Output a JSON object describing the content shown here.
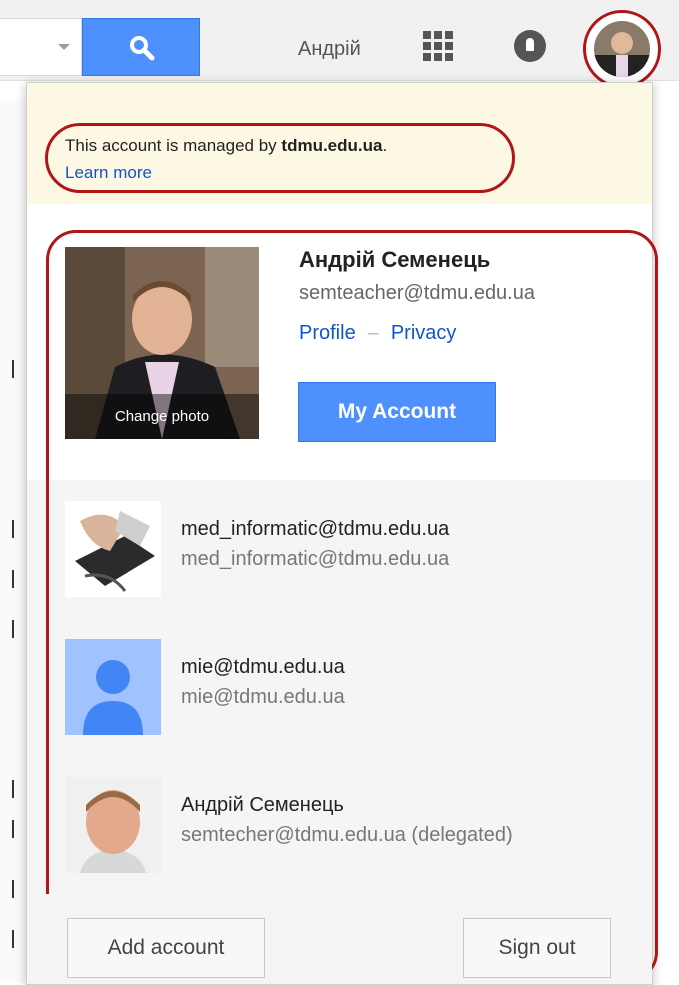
{
  "header": {
    "username": "Андрій",
    "icons": {
      "search": "search-icon",
      "apps": "apps-grid-icon",
      "notifications": "notifications-icon",
      "avatar": "avatar"
    }
  },
  "notice": {
    "text_prefix": "This account is managed by ",
    "domain": "tdmu.edu.ua",
    "text_suffix": ".",
    "learn_more": "Learn more"
  },
  "current_account": {
    "name": "Андрій Семенець",
    "email": "semteacher@tdmu.edu.ua",
    "change_photo": "Change photo",
    "profile_link": "Profile",
    "separator": "–",
    "privacy_link": "Privacy",
    "my_account_button": "My Account"
  },
  "other_accounts": [
    {
      "name": "med_informatic@tdmu.edu.ua",
      "email": "med_informatic@tdmu.edu.ua"
    },
    {
      "name": "mie@tdmu.edu.ua",
      "email": "mie@tdmu.edu.ua"
    },
    {
      "name": "Андрій Семенець",
      "email": "semtecher@tdmu.edu.ua (delegated)"
    }
  ],
  "footer": {
    "add_account": "Add account",
    "sign_out": "Sign out"
  },
  "colors": {
    "accent_blue": "#4d90fe",
    "link_blue": "#1155cc",
    "annotation_red": "#b01616",
    "notice_bg": "#fcf8e3"
  }
}
